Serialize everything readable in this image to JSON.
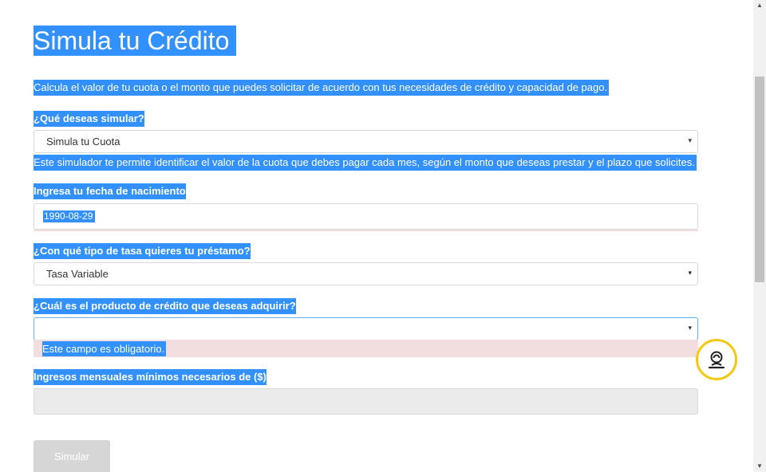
{
  "page": {
    "title": "Simula tu Crédito",
    "intro": "Calcula el valor de tu cuota o el monto que puedes solicitar de acuerdo con tus necesidades de crédito y capacidad de pago."
  },
  "form": {
    "simulate_label": "¿Qué deseas simular?",
    "simulate_value": "Simula tu Cuota",
    "simulate_help": "Este simulador te permite identificar el valor de la cuota que debes pagar cada mes, según el monto que deseas prestar y el plazo que solicites.",
    "birth_label": "Ingresa tu fecha de nacimiento",
    "birth_value": "1990-08-29",
    "rate_label": "¿Con qué tipo de tasa quieres tu préstamo?",
    "rate_value": "Tasa Variable",
    "product_label": "¿Cuál es el producto de crédito que deseas adquirir?",
    "product_value": "",
    "product_error": "Este campo es obligatorio.",
    "income_label": "Ingresos mensuales mínimos necesarios de ($)",
    "submit_label": "Simular"
  },
  "icons": {
    "caret": "▾",
    "chat": "chat-support-icon",
    "scroll_up": "▲",
    "scroll_down": "▼"
  },
  "colors": {
    "selection": "#3390ff",
    "error_bg": "#f2dede",
    "chat_ring": "#f2c811",
    "focus_border": "#66afe9"
  }
}
